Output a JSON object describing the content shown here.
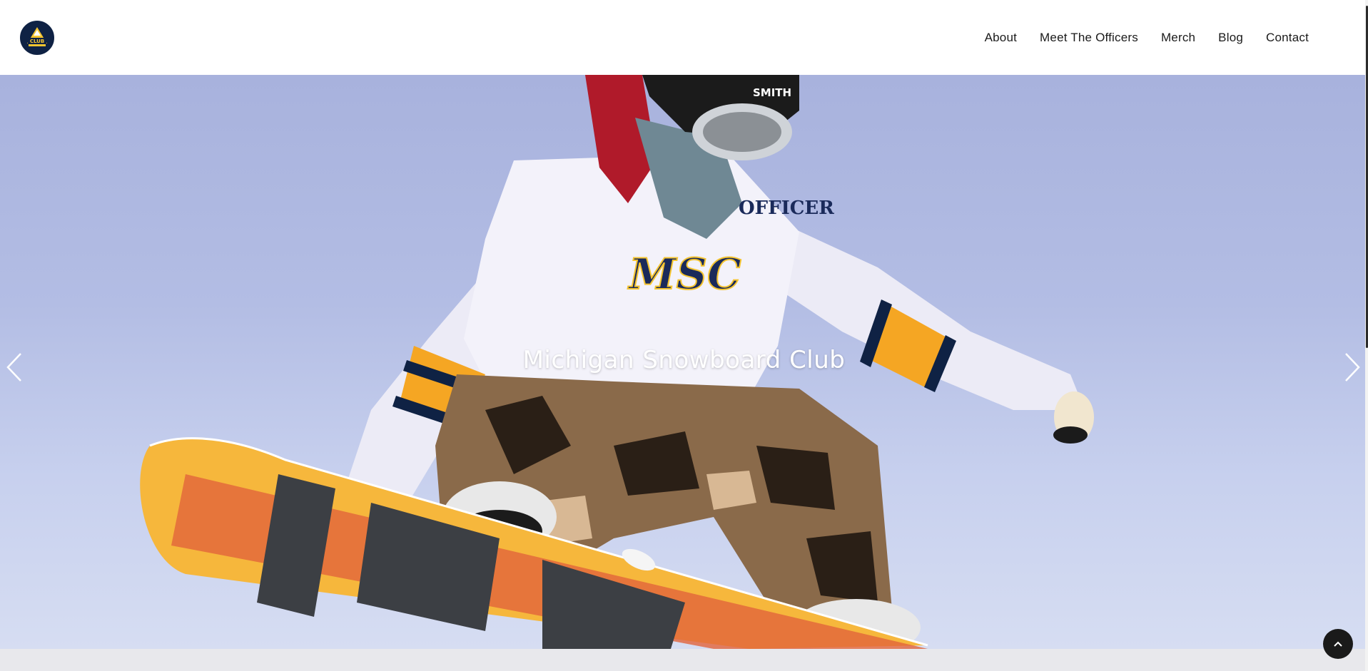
{
  "brand": {
    "logo_icon": "msc-logo-icon",
    "logo_text": "CLUB",
    "colors": {
      "navy": "#0f2244",
      "maize": "#f4c430"
    }
  },
  "nav": {
    "items": [
      {
        "label": "About"
      },
      {
        "label": "Meet The Officers"
      },
      {
        "label": "Merch"
      },
      {
        "label": "Blog"
      },
      {
        "label": "Contact"
      }
    ]
  },
  "hero": {
    "title": "Michigan Snowboard Club",
    "prev_icon": "chevron-left-icon",
    "next_icon": "chevron-right-icon",
    "jersey_text": "OFFICER",
    "jersey_script": "MSC",
    "helmet_text": "SMITH"
  },
  "to_top": {
    "icon": "chevron-up-icon"
  }
}
